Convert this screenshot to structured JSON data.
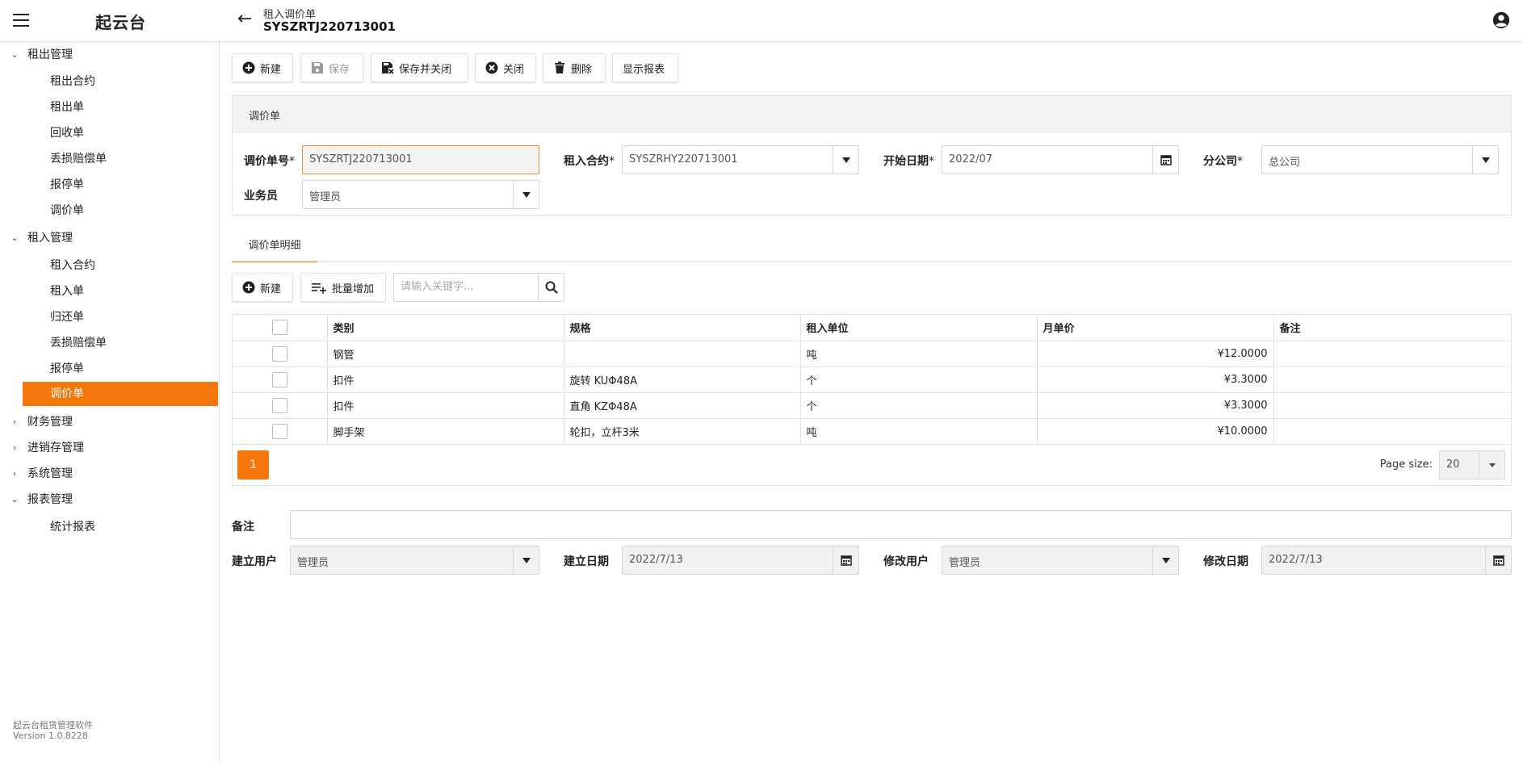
{
  "header": {
    "app_title": "起云台",
    "page_subtitle": "租入调价单",
    "doc_number": "SYSZRTJ220713001"
  },
  "sidebar": {
    "groups": [
      {
        "label": "租出管理",
        "expanded": true,
        "items": [
          "租出合约",
          "租出单",
          "回收单",
          "丢损赔偿单",
          "报停单",
          "调价单"
        ]
      },
      {
        "label": "租入管理",
        "expanded": true,
        "items": [
          "租入合约",
          "租入单",
          "归还单",
          "丢损赔偿单",
          "报停单",
          "调价单"
        ]
      },
      {
        "label": "财务管理",
        "expanded": false
      },
      {
        "label": "进销存管理",
        "expanded": false
      },
      {
        "label": "系统管理",
        "expanded": false
      },
      {
        "label": "报表管理",
        "expanded": true,
        "items": [
          "统计报表"
        ]
      }
    ],
    "active_item": "租入管理/调价单",
    "footer": {
      "line1": "起云台租赁管理软件",
      "line2": "Version 1.0.8228"
    }
  },
  "toolbar": {
    "new": "新建",
    "save": "保存",
    "save_close": "保存并关闭",
    "close": "关闭",
    "delete": "删除",
    "show_report": "显示报表"
  },
  "form": {
    "panel_title": "调价单",
    "doc_no_label": "调价单号",
    "doc_no_value": "SYSZRTJ220713001",
    "contract_label": "租入合约",
    "contract_value": "SYSZRHY220713001",
    "start_date_label": "开始日期",
    "start_date_value": "2022/07",
    "branch_label": "分公司",
    "branch_value": "总公司",
    "salesman_label": "业务员",
    "salesman_value": "管理员",
    "required_mark": "*"
  },
  "detail": {
    "tab_label": "调价单明细",
    "new_button": "新建",
    "batch_add_button": "批量增加",
    "search_placeholder": "请输入关键字...",
    "columns": [
      "类别",
      "规格",
      "租入单位",
      "月单价",
      "备注"
    ],
    "rows": [
      {
        "category": "钢管",
        "spec": "",
        "unit": "吨",
        "price": "¥12.0000",
        "note": ""
      },
      {
        "category": "扣件",
        "spec": "旋转 KUΦ48A",
        "unit": "个",
        "price": "¥3.3000",
        "note": ""
      },
      {
        "category": "扣件",
        "spec": "直角 KZΦ48A",
        "unit": "个",
        "price": "¥3.3000",
        "note": ""
      },
      {
        "category": "脚手架",
        "spec": "轮扣，立杆3米",
        "unit": "吨",
        "price": "¥10.0000",
        "note": ""
      }
    ],
    "pager": {
      "current_page": "1",
      "page_size_label": "Page size:",
      "page_size": "20"
    }
  },
  "footer_form": {
    "note_label": "备注",
    "note_value": "",
    "created_by_label": "建立用户",
    "created_by_value": "管理员",
    "created_date_label": "建立日期",
    "created_date_value": "2022/7/13",
    "modified_by_label": "修改用户",
    "modified_by_value": "管理员",
    "modified_date_label": "修改日期",
    "modified_date_value": "2022/7/13"
  },
  "colors": {
    "accent": "#f5770b"
  }
}
